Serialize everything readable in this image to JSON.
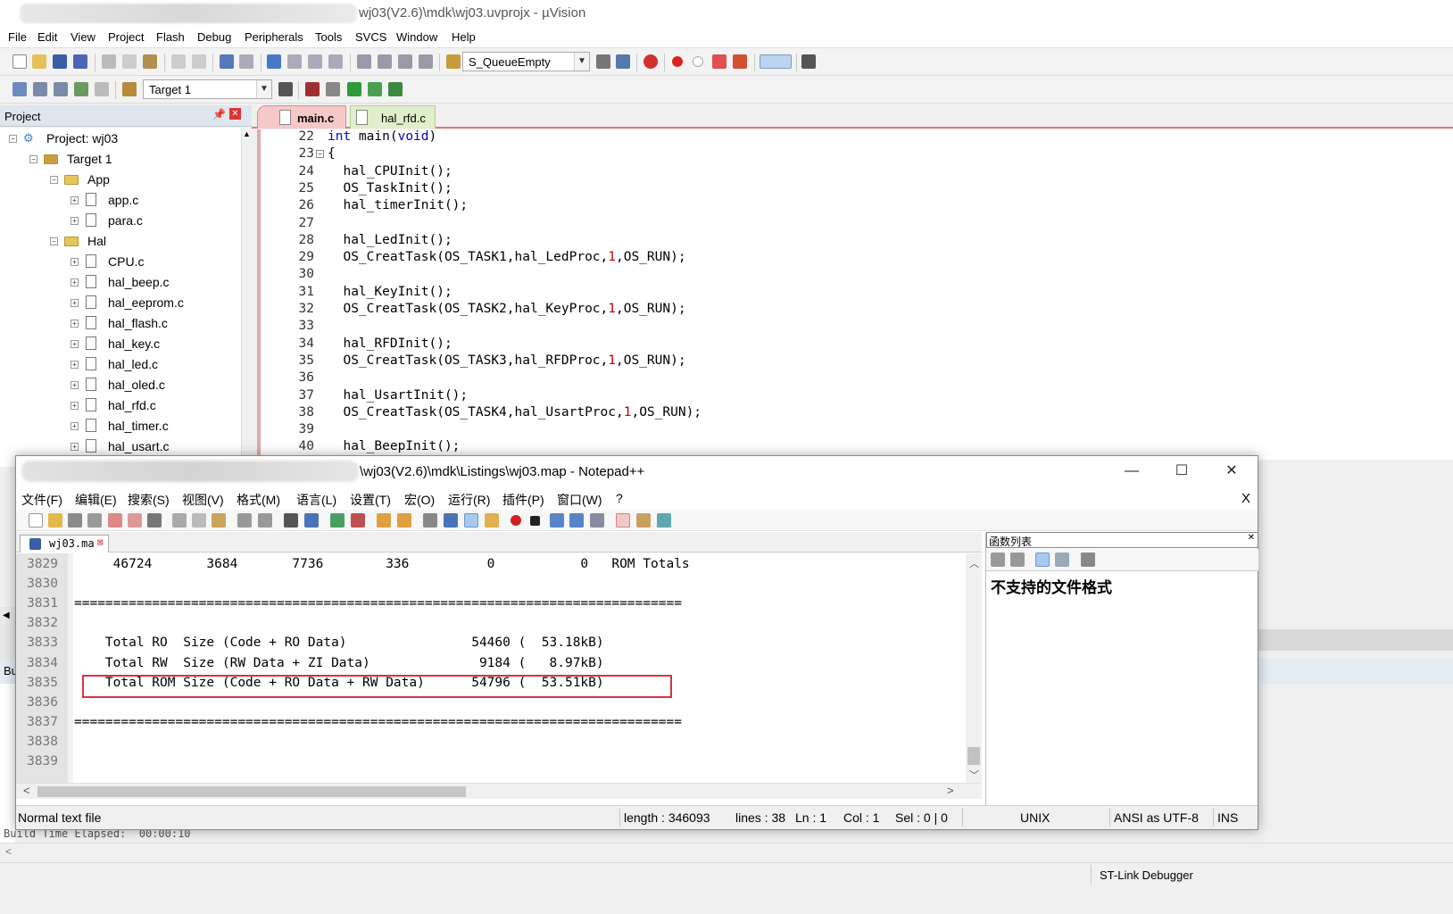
{
  "uvision": {
    "title": "wj03(V2.6)\\mdk\\wj03.uvprojx - µVision",
    "menu": [
      "File",
      "Edit",
      "View",
      "Project",
      "Flash",
      "Debug",
      "Peripherals",
      "Tools",
      "SVCS",
      "Window",
      "Help"
    ],
    "find_combo": "S_QueueEmpty",
    "target_combo": "Target 1",
    "project_pane_title": "Project",
    "tree": {
      "root": "Project: wj03",
      "target": "Target 1",
      "group_app": "App",
      "app_files": [
        "app.c",
        "para.c"
      ],
      "group_hal": "Hal",
      "hal_files": [
        "CPU.c",
        "hal_beep.c",
        "hal_eeprom.c",
        "hal_flash.c",
        "hal_key.c",
        "hal_led.c",
        "hal_oled.c",
        "hal_rfd.c",
        "hal_timer.c",
        "hal_usart.c"
      ]
    },
    "tabs": [
      "main.c",
      "hal_rfd.c"
    ],
    "code_line_numbers": [
      "22",
      "23",
      "24",
      "25",
      "26",
      "27",
      "28",
      "29",
      "30",
      "31",
      "32",
      "33",
      "34",
      "35",
      "36",
      "37",
      "38",
      "39",
      "40"
    ],
    "code": [
      {
        "kw": "int",
        "rest": " main(",
        "kw2": "void",
        "end": ")"
      },
      {
        "text": "{"
      },
      {
        "text": "  hal_CPUInit();"
      },
      {
        "text": "  OS_TaskInit();"
      },
      {
        "text": "  hal_timerInit();"
      },
      {
        "text": ""
      },
      {
        "text": "  hal_LedInit();"
      },
      {
        "pre": "  OS_CreatTask(OS_TASK1,hal_LedProc,",
        "num": "1",
        "post": ",OS_RUN);"
      },
      {
        "text": ""
      },
      {
        "text": "  hal_KeyInit();"
      },
      {
        "pre": "  OS_CreatTask(OS_TASK2,hal_KeyProc,",
        "num": "1",
        "post": ",OS_RUN);"
      },
      {
        "text": ""
      },
      {
        "text": "  hal_RFDInit();"
      },
      {
        "pre": "  OS_CreatTask(OS_TASK3,hal_RFDProc,",
        "num": "1",
        "post": ",OS_RUN);"
      },
      {
        "text": ""
      },
      {
        "text": "  hal_UsartInit();"
      },
      {
        "pre": "  OS_CreatTask(OS_TASK4,hal_UsartProc,",
        "num": "1",
        "post": ",OS_RUN);"
      },
      {
        "text": ""
      },
      {
        "text": "  hal_BeepInit();"
      }
    ],
    "build_tab": "Bu",
    "status_debugger": "ST-Link Debugger",
    "bottom_fragments": [
      "Build Time Elapsed:  00:00:10"
    ]
  },
  "notepadpp": {
    "title": "\\wj03(V2.6)\\mdk\\Listings\\wj03.map - Notepad++",
    "min": "—",
    "max": "☐",
    "close": "✕",
    "close_doc": "X",
    "menu": [
      "文件(F)",
      "编辑(E)",
      "搜索(S)",
      "视图(V)",
      "格式(M)",
      "语言(L)",
      "设置(T)",
      "宏(O)",
      "运行(R)",
      "插件(P)",
      "窗口(W)",
      "?"
    ],
    "tab": "wj03.ma",
    "lines": [
      {
        "n": "3829",
        "text": "     46724       3684       7736        336          0           0   ROM Totals"
      },
      {
        "n": "3830",
        "text": ""
      },
      {
        "n": "3831",
        "text": "=============================================================================="
      },
      {
        "n": "3832",
        "text": ""
      },
      {
        "n": "3833",
        "text": "    Total RO  Size (Code + RO Data)                54460 (  53.18kB)"
      },
      {
        "n": "3834",
        "text": "    Total RW  Size (RW Data + ZI Data)              9184 (   8.97kB)"
      },
      {
        "n": "3835",
        "text": "    Total ROM Size (Code + RO Data + RW Data)      54796 (  53.51kB)"
      },
      {
        "n": "3836",
        "text": ""
      },
      {
        "n": "3837",
        "text": "=============================================================================="
      },
      {
        "n": "3838",
        "text": ""
      },
      {
        "n": "3839",
        "text": ""
      }
    ],
    "function_list_title": "函数列表",
    "function_list_msg": "不支持的文件格式",
    "status": {
      "type": "Normal text file",
      "length": "length : 346093",
      "lines": "lines : 38",
      "ln": "Ln : 1",
      "col": "Col : 1",
      "sel": "Sel : 0 | 0",
      "eol": "UNIX",
      "encoding": "ANSI as UTF-8",
      "mode": "INS"
    }
  },
  "colors": {
    "highlight_box": "#d9343a",
    "keyword": "#0000c8",
    "number": "#c00000",
    "editor_tab_accent": "#e07a7a"
  }
}
